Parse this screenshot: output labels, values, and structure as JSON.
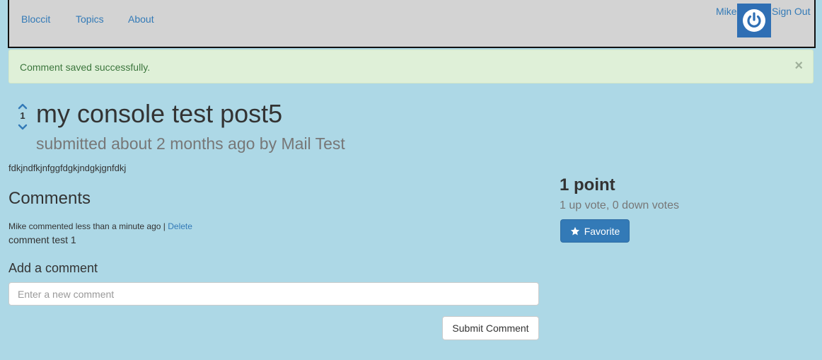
{
  "nav": {
    "brand": "Bloccit",
    "topics": "Topics",
    "about": "About",
    "user": "Mike",
    "signout": "Sign Out",
    "avatar_icon": "power-icon"
  },
  "alert": {
    "message": "Comment saved successfully.",
    "close": "×"
  },
  "post": {
    "votes": "1",
    "title": "my console test post5",
    "submitted": "submitted about 2 months ago by Mail Test",
    "body": "fdkjndfkjnfggfdgkjndgkjgnfdkj"
  },
  "comments": {
    "heading": "Comments",
    "items": [
      {
        "meta": "Mike commented less than a minute ago |",
        "delete": "Delete",
        "body": "comment test 1"
      }
    ]
  },
  "add_comment": {
    "heading": "Add a comment",
    "placeholder": "Enter a new comment",
    "submit": "Submit Comment"
  },
  "sidebar": {
    "points": "1 point",
    "votes_detail": "1 up vote, 0 down votes",
    "favorite": "Favorite"
  },
  "colors": {
    "page_bg": "#add8e6",
    "navbar_bg": "#d3d3d3",
    "link": "#337ab7",
    "alert_bg": "#dff0d8",
    "alert_text": "#3c763d",
    "primary_button": "#337ab7"
  }
}
